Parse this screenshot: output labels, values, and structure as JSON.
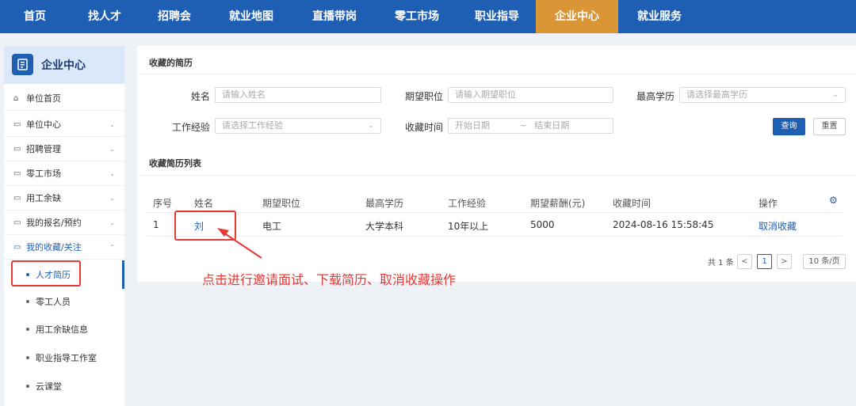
{
  "nav": {
    "items": [
      "首页",
      "找人才",
      "招聘会",
      "就业地图",
      "直播带岗",
      "零工市场",
      "职业指导",
      "企业中心",
      "就业服务"
    ],
    "active": "企业中心"
  },
  "sidebar": {
    "title": "企业中心",
    "items": [
      {
        "label": "单位首页",
        "icon": "home-icon"
      },
      {
        "label": "单位中心",
        "icon": "folder-icon"
      },
      {
        "label": "招聘管理",
        "icon": "folder-icon"
      },
      {
        "label": "零工市场",
        "icon": "folder-icon"
      },
      {
        "label": "用工余缺",
        "icon": "folder-icon"
      },
      {
        "label": "我的报名/预约",
        "icon": "folder-icon"
      },
      {
        "label": "我的收藏/关注",
        "icon": "folder-icon"
      }
    ],
    "sub_items": [
      "人才简历",
      "零工人员",
      "用工余缺信息",
      "职业指导工作室",
      "云课堂"
    ]
  },
  "main": {
    "section_title": "收藏的简历",
    "form": {
      "name_label": "姓名",
      "name_placeholder": "请输入姓名",
      "position_label": "期望职位",
      "position_placeholder": "请输入期望职位",
      "edu_label": "最高学历",
      "edu_placeholder": "请选择最高学历",
      "exp_label": "工作经验",
      "exp_placeholder": "请选择工作经验",
      "time_label": "收藏时间",
      "start_placeholder": "开始日期",
      "range_sep": "~",
      "end_placeholder": "结束日期",
      "query_button": "查询",
      "reset_button": "重置"
    },
    "list_title": "收藏简历列表",
    "table": {
      "headers": [
        "序号",
        "姓名",
        "期望职位",
        "最高学历",
        "工作经验",
        "期望薪酬(元)",
        "收藏时间",
        "操作"
      ],
      "rows": [
        {
          "index": "1",
          "name": "刘",
          "position": "电工",
          "education": "大学本科",
          "experience": "10年以上",
          "salary": "5000",
          "time": "2024-08-16 15:58:45",
          "action": "取消收藏"
        }
      ]
    },
    "pagination": {
      "total": "共 1 条",
      "prev": "<",
      "current": "1",
      "next": ">",
      "page_size": "10 条/页"
    }
  },
  "annotation": {
    "text": "点击进行邀请面试、下载简历、取消收藏操作",
    "color": "#e53935"
  },
  "colors": {
    "nav_bg": "#1e5fb4",
    "nav_active": "#d99536",
    "accent": "#1e5fb4"
  }
}
